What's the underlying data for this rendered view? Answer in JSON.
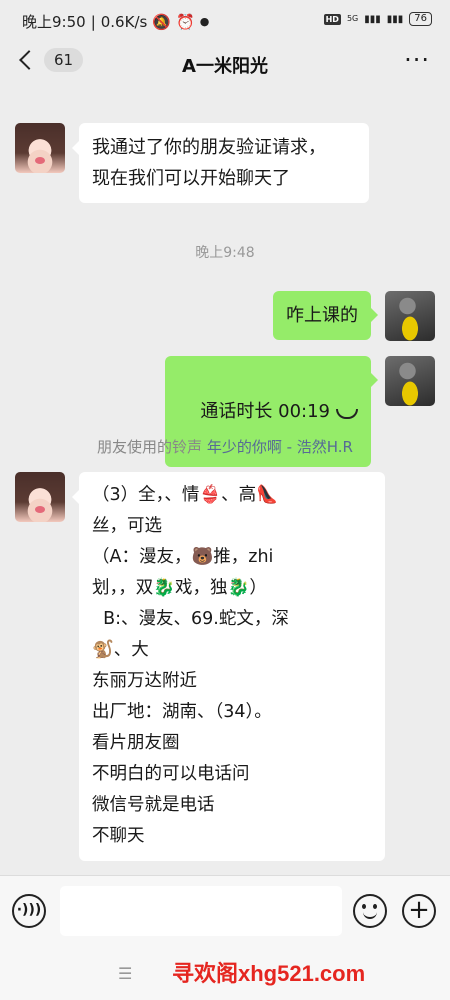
{
  "status_bar": {
    "time": "晚上9:50",
    "net_speed": "0.6K/s",
    "hd": "HD",
    "signal": "5G",
    "battery": "76"
  },
  "nav": {
    "unread_count": "61",
    "title": "A一米阳光",
    "more": "···"
  },
  "messages": [
    {
      "side": "left",
      "text": "我通过了你的朋友验证请求，\n现在我们可以开始聊天了"
    },
    {
      "type": "time",
      "text": "晚上9:48"
    },
    {
      "side": "right",
      "text": "咋上课的"
    },
    {
      "side": "right",
      "call_label": "通话时长 00:19"
    },
    {
      "type": "ringtone",
      "prefix": "朋友使用的铃声",
      "song": "年少的你啊 - 浩然H.R"
    },
    {
      "side": "left",
      "text": "（3）全，、情👙、高👠\n丝，可选\n（A：漫友，🐻推，zhi\n划，，双🐉戏，独🐉）\n  B:、漫友、69.蛇文，深\n🐒、大\n东丽万达附近\n出厂地：湖南、（34）。\n看片朋友圈\n不明白的可以电话问\n微信号就是电话\n不聊天"
    }
  ],
  "bottom_bar": {
    "voice": "·)))",
    "plus": "+",
    "menu": "☰",
    "watermark": "寻欢阁xhg521.com"
  }
}
